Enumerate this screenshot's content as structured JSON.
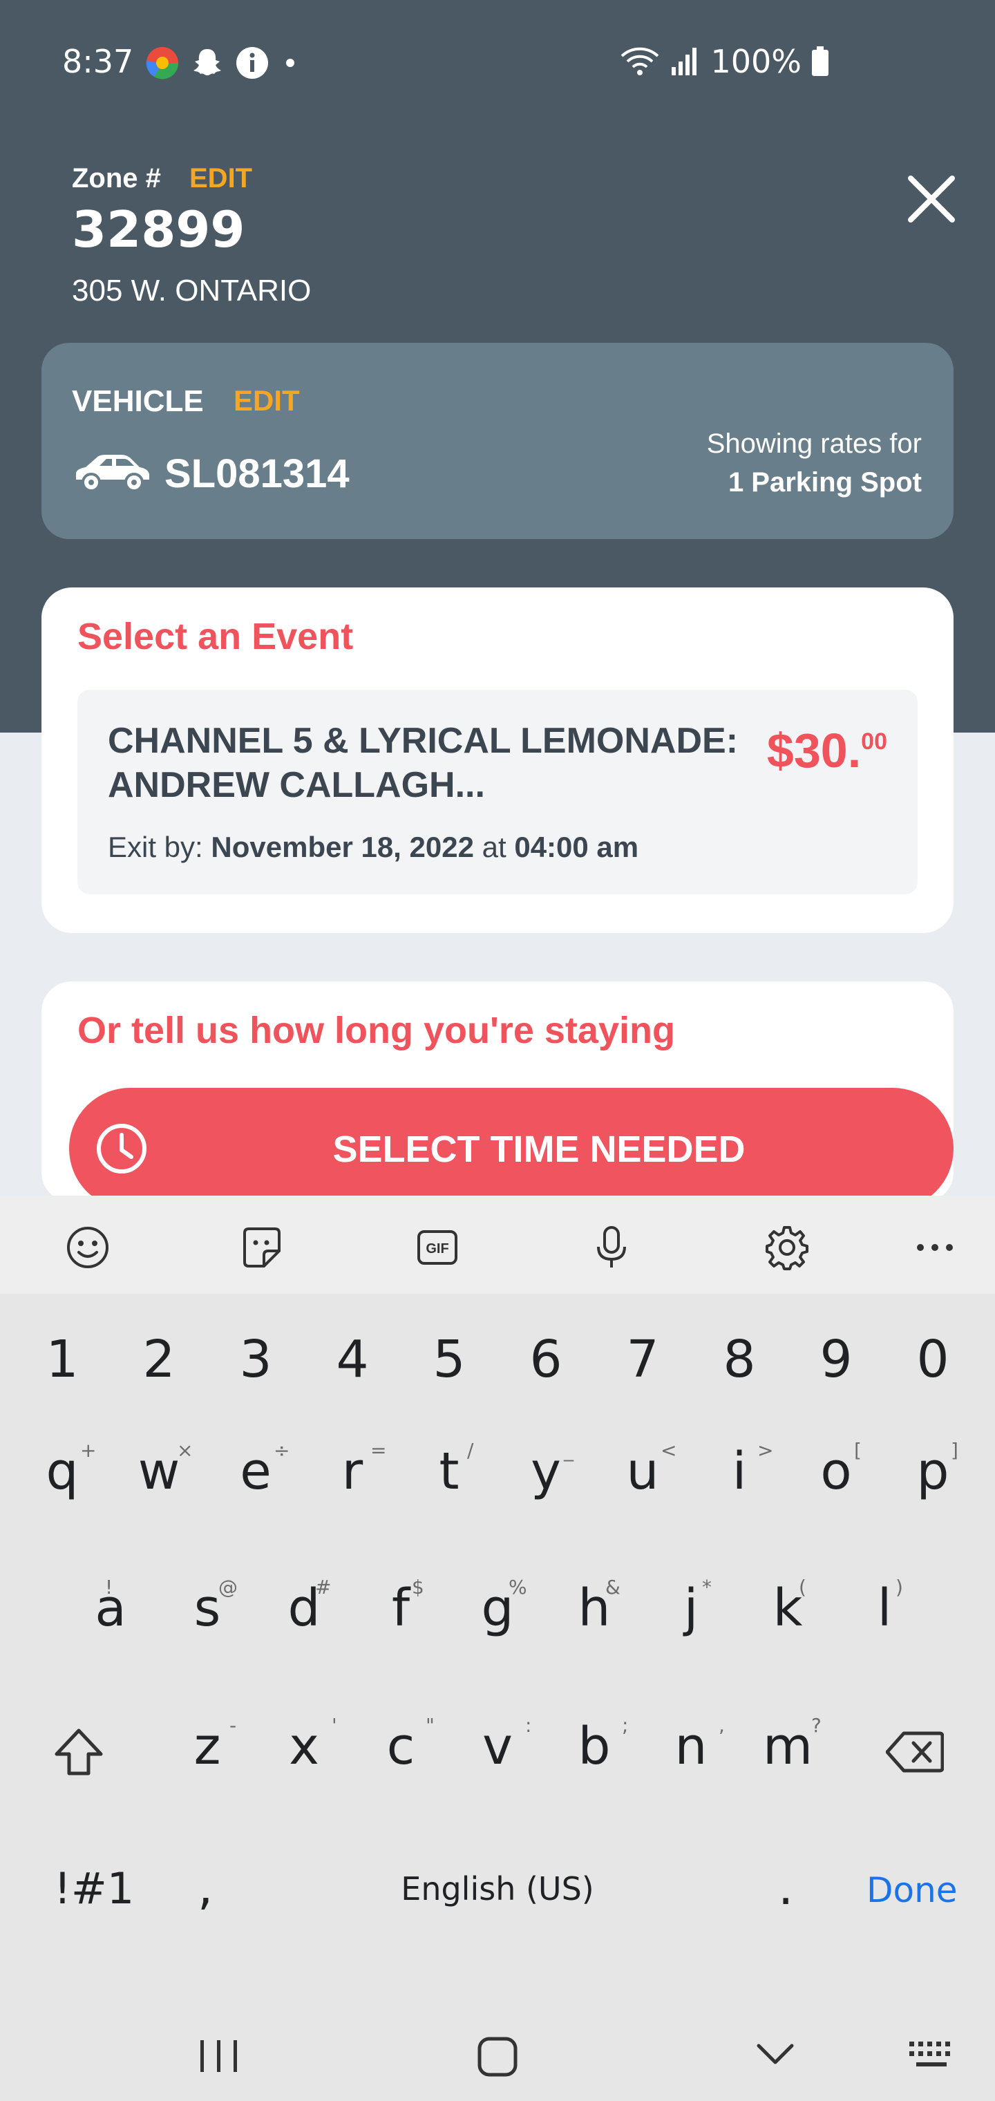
{
  "status_bar": {
    "time": "8:37",
    "battery": "100%"
  },
  "zone": {
    "label": "Zone #",
    "edit": "EDIT",
    "number": "32899",
    "address": "305 W. ONTARIO"
  },
  "vehicle": {
    "label": "VEHICLE",
    "edit": "EDIT",
    "plate": "SL081314",
    "rates_line1": "Showing rates for",
    "rates_line2": "1 Parking Spot"
  },
  "event": {
    "heading": "Select an Event",
    "title": "CHANNEL 5 & LYRICAL LEMONADE: ANDREW CALLAGH...",
    "price_main": "$30.",
    "price_cents": "00",
    "exit_prefix": "Exit by:",
    "exit_date": "November 18, 2022",
    "exit_at": "at",
    "exit_time": "04:00 am"
  },
  "duration": {
    "heading": "Or tell us how long you're staying",
    "button": "SELECT TIME NEEDED"
  },
  "keyboard": {
    "numbers": [
      "1",
      "2",
      "3",
      "4",
      "5",
      "6",
      "7",
      "8",
      "9",
      "0"
    ],
    "row1": [
      {
        "k": "q",
        "h": "+"
      },
      {
        "k": "w",
        "h": "×"
      },
      {
        "k": "e",
        "h": "÷"
      },
      {
        "k": "r",
        "h": "="
      },
      {
        "k": "t",
        "h": "/"
      },
      {
        "k": "y",
        "h": "_"
      },
      {
        "k": "u",
        "h": "<"
      },
      {
        "k": "i",
        "h": ">"
      },
      {
        "k": "o",
        "h": "["
      },
      {
        "k": "p",
        "h": "]"
      }
    ],
    "row2": [
      {
        "k": "a",
        "h": "!"
      },
      {
        "k": "s",
        "h": "@"
      },
      {
        "k": "d",
        "h": "#"
      },
      {
        "k": "f",
        "h": "$"
      },
      {
        "k": "g",
        "h": "%"
      },
      {
        "k": "h",
        "h": "&"
      },
      {
        "k": "j",
        "h": "*"
      },
      {
        "k": "k",
        "h": "("
      },
      {
        "k": "l",
        "h": ")"
      }
    ],
    "row3": [
      {
        "k": "z",
        "h": "-"
      },
      {
        "k": "x",
        "h": "'"
      },
      {
        "k": "c",
        "h": "\""
      },
      {
        "k": "v",
        "h": ":"
      },
      {
        "k": "b",
        "h": ";"
      },
      {
        "k": "n",
        "h": ","
      },
      {
        "k": "m",
        "h": "?"
      }
    ],
    "symbols_key": "!#1",
    "comma_key": ",",
    "space_label": "English (US)",
    "period_key": ".",
    "done_key": "Done"
  },
  "colors": {
    "header_bg": "#4a5964",
    "vehicle_card": "#687f8b",
    "accent_red": "#f0535c",
    "accent_orange": "#f5a623",
    "done_blue": "#1a73e8"
  }
}
